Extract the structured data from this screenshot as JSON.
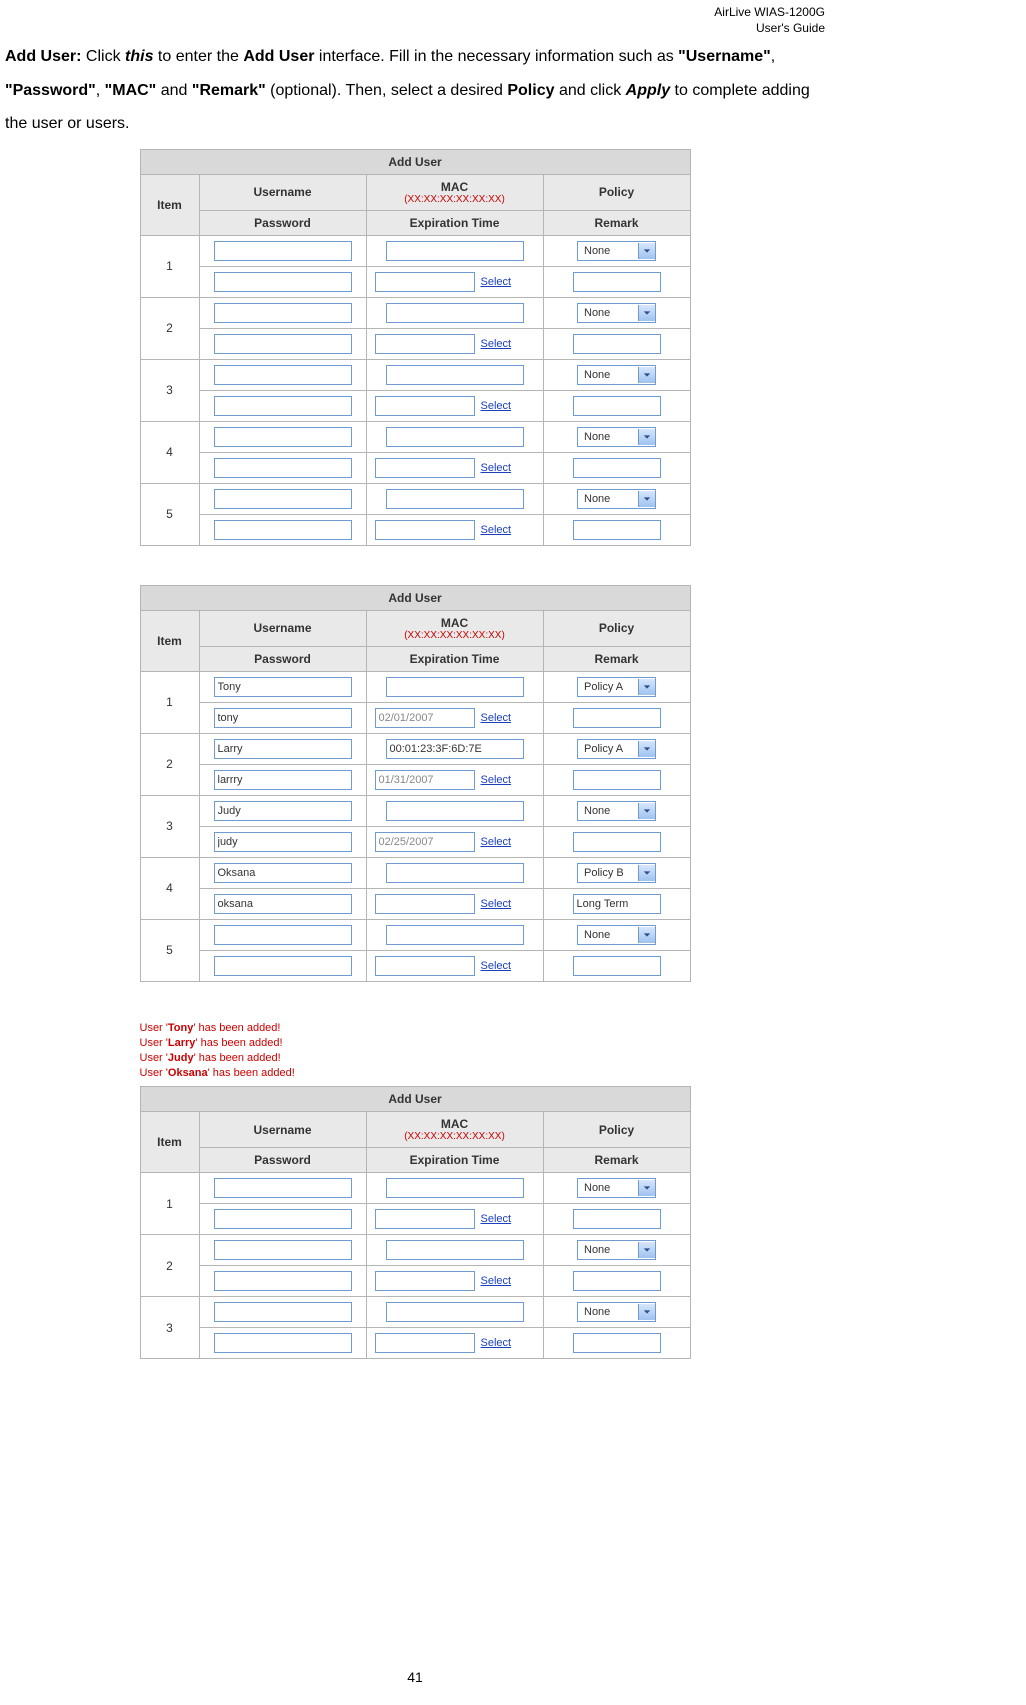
{
  "header": {
    "product": "AirLive WIAS-1200G",
    "doc": "User's Guide"
  },
  "intro": {
    "lead": "Add User:",
    "p1a": " Click ",
    "this": "this",
    "p1b": " to enter the ",
    "addUser": "Add User",
    "p1c": " interface. Fill in the necessary information such as ",
    "username": "\"Username\"",
    "comma": ", ",
    "password": "\"Password\"",
    "mac": "\"MAC\"",
    "and": " and ",
    "remark": "\"Remark\"",
    "opt": " (optional). Then, select a desired ",
    "policy": "Policy",
    "p1d": " and click ",
    "apply": "Apply",
    "p1e": " to complete adding the user or users."
  },
  "tableTitle": "Add User",
  "headers": {
    "item": "Item",
    "username": "Username",
    "mac": "MAC",
    "macFmt": "(XX:XX:XX:XX:XX:XX)",
    "policy": "Policy",
    "password": "Password",
    "expiration": "Expiration Time",
    "remark": "Remark"
  },
  "selectLink": "Select",
  "table1": {
    "rows": [
      {
        "n": "1",
        "username": "",
        "mac": "",
        "policy": "None",
        "password": "",
        "exp": "",
        "remark": ""
      },
      {
        "n": "2",
        "username": "",
        "mac": "",
        "policy": "None",
        "password": "",
        "exp": "",
        "remark": ""
      },
      {
        "n": "3",
        "username": "",
        "mac": "",
        "policy": "None",
        "password": "",
        "exp": "",
        "remark": ""
      },
      {
        "n": "4",
        "username": "",
        "mac": "",
        "policy": "None",
        "password": "",
        "exp": "",
        "remark": ""
      },
      {
        "n": "5",
        "username": "",
        "mac": "",
        "policy": "None",
        "password": "",
        "exp": "",
        "remark": ""
      }
    ]
  },
  "table2": {
    "rows": [
      {
        "n": "1",
        "username": "Tony",
        "mac": "",
        "policy": "Policy A",
        "password": "tony",
        "exp": "02/01/2007",
        "remark": ""
      },
      {
        "n": "2",
        "username": "Larry",
        "mac": "00:01:23:3F:6D:7E",
        "policy": "Policy A",
        "password": "larrry",
        "exp": "01/31/2007",
        "remark": ""
      },
      {
        "n": "3",
        "username": "Judy",
        "mac": "",
        "policy": "None",
        "password": "judy",
        "exp": "02/25/2007",
        "remark": ""
      },
      {
        "n": "4",
        "username": "Oksana",
        "mac": "",
        "policy": "Policy B",
        "password": "oksana",
        "exp": "",
        "remark": "Long Term"
      },
      {
        "n": "5",
        "username": "",
        "mac": "",
        "policy": "None",
        "password": "",
        "exp": "",
        "remark": ""
      }
    ]
  },
  "statusMsgs": [
    "User 'Tony' has been added!",
    "User 'Larry' has been added!",
    "User 'Judy' has been added!",
    "User 'Oksana' has been added!"
  ],
  "table3": {
    "rows": [
      {
        "n": "1",
        "username": "",
        "mac": "",
        "policy": "None",
        "password": "",
        "exp": "",
        "remark": ""
      },
      {
        "n": "2",
        "username": "",
        "mac": "",
        "policy": "None",
        "password": "",
        "exp": "",
        "remark": ""
      },
      {
        "n": "3",
        "username": "",
        "mac": "",
        "policy": "None",
        "password": "",
        "exp": "",
        "remark": ""
      }
    ]
  },
  "pageNumber": "41"
}
